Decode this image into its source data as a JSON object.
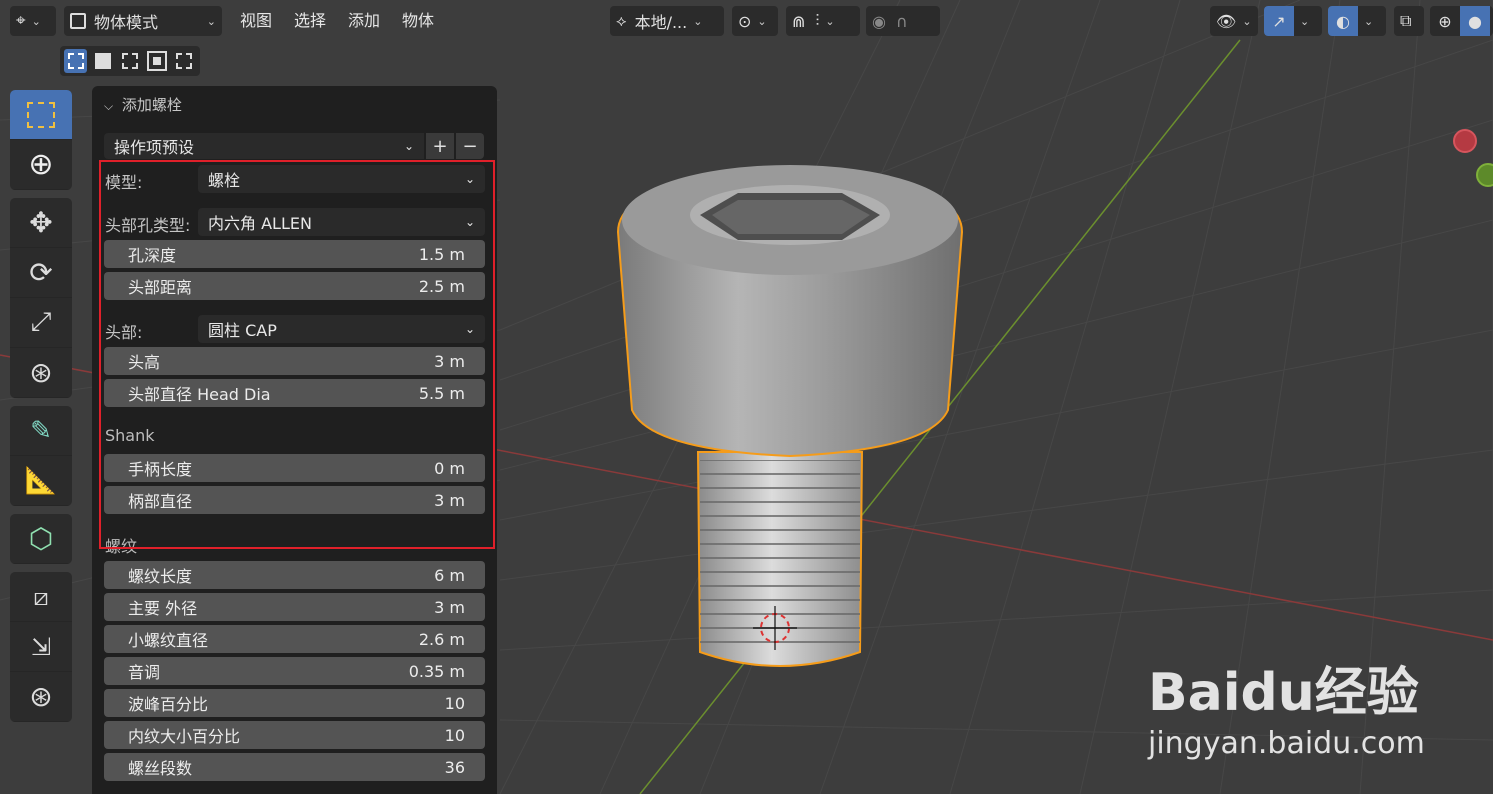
{
  "header": {
    "mode_label": "物体模式",
    "menus": [
      "视图",
      "选择",
      "添加",
      "物体"
    ],
    "orientation_label": "本地/..."
  },
  "panel": {
    "title": "添加螺栓",
    "preset_label": "操作项预设",
    "preset_add": "+",
    "preset_remove": "−",
    "model_label": "模型:",
    "model_value": "螺栓",
    "head_hole_label": "头部孔类型:",
    "head_hole_value": "内六角 ALLEN",
    "hole_depth_label": "孔深度",
    "hole_depth_value": "1.5 m",
    "head_distance_label": "头部距离",
    "head_distance_value": "2.5 m",
    "head_label": "头部:",
    "head_value": "圆柱 CAP",
    "head_height_label": "头高",
    "head_height_value": "3 m",
    "head_dia_label": "头部直径 Head Dia",
    "head_dia_value": "5.5 m",
    "shank_section": "Shank",
    "shank_length_label": "手柄长度",
    "shank_length_value": "0 m",
    "shank_dia_label": "柄部直径",
    "shank_dia_value": "3 m",
    "thread_section": "螺纹",
    "thread_length_label": "螺纹长度",
    "thread_length_value": "6 m",
    "major_dia_label": "主要 外径",
    "major_dia_value": "3 m",
    "minor_dia_label": "小螺纹直径",
    "minor_dia_value": "2.6 m",
    "pitch_label": "音调",
    "pitch_value": "0.35 m",
    "crest_label": "波峰百分比",
    "crest_value": "10",
    "root_label": "内纹大小百分比",
    "root_value": "10",
    "segments_label": "螺丝段数",
    "segments_value": "36"
  },
  "watermark": {
    "brand": "Baidu经验",
    "url": "jingyan.baidu.com"
  },
  "colors": {
    "accent": "#4772b3",
    "highlight": "#e0202a",
    "selection_outline": "#f59c1a"
  }
}
